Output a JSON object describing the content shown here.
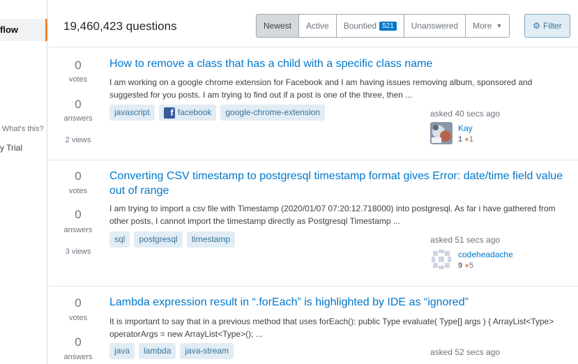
{
  "sidebar": {
    "active_item": "flow",
    "what_link": "What's this?",
    "trial_text": "y Trial"
  },
  "header": {
    "question_count": "19,460,423 questions",
    "tabs": [
      {
        "label": "Newest",
        "active": true
      },
      {
        "label": "Active"
      },
      {
        "label": "Bountied",
        "badge": "521"
      },
      {
        "label": "Unanswered"
      },
      {
        "label": "More"
      }
    ],
    "filter_label": "Filter"
  },
  "questions": [
    {
      "votes": "0",
      "votes_label": "votes",
      "answers": "0",
      "answers_label": "answers",
      "views": "2 views",
      "title": "How to remove a class that has a child with a specific class name",
      "excerpt": "I am working on a google chrome extension for Facebook and I am having issues removing album, sponsored and suggested for you posts. I am trying to find out if a post is one of the three, then ...",
      "tags": [
        "javascript",
        "facebook",
        "google-chrome-extension"
      ],
      "asked": "asked 40 secs ago",
      "user": "Kay",
      "rep": "1",
      "bronze": "1"
    },
    {
      "votes": "0",
      "votes_label": "votes",
      "answers": "0",
      "answers_label": "answers",
      "views": "3 views",
      "title": "Converting CSV timestamp to postgresql timestamp format gives Error: date/time field value out of range",
      "excerpt": "I am trying to import a csv file with Timestamp (2020/01/07 07:20:12.718000) into postgresql. As far i have gathered from other posts, I cannot import the timestamp directly as Postgresql Timestamp ...",
      "tags": [
        "sql",
        "postgresql",
        "timestamp"
      ],
      "asked": "asked 51 secs ago",
      "user": "codeheadache",
      "rep": "9",
      "bronze": "5"
    },
    {
      "votes": "0",
      "votes_label": "votes",
      "answers": "0",
      "answers_label": "answers",
      "title": "Lambda expression result in “.forEach” is highlighted by IDE as “ignored”",
      "excerpt": "It is important to say that in a previous method that uses forEach(): public Type evaluate( Type[] args ) { ArrayList<Type> operatorArgs = new ArrayList<Type>(); ...",
      "tags": [
        "java",
        "lambda",
        "java-stream"
      ],
      "asked": "asked 52 secs ago"
    }
  ],
  "colors": {
    "link": "#0077cc",
    "tag_bg": "#e1ecf4",
    "tag_fg": "#39739d",
    "accent": "#f48024",
    "badge": "#0077cc"
  }
}
